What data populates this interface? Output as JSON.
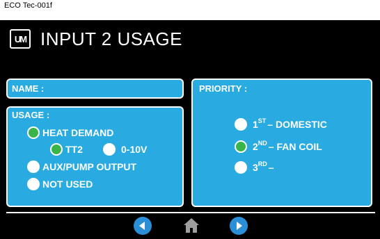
{
  "caption": "ECO Tec-001f",
  "header": {
    "title": "INPUT 2 USAGE",
    "logo_text": "UM"
  },
  "name_panel": {
    "label": "NAME :"
  },
  "usage_panel": {
    "label": "USAGE :",
    "options": {
      "heat_demand": {
        "label": "HEAT DEMAND",
        "selected": true
      },
      "tt2": {
        "label": "TT2",
        "selected": true
      },
      "zero_ten_v": {
        "label": "0-10V",
        "selected": false
      },
      "aux_pump": {
        "label": "AUX/PUMP OUTPUT",
        "selected": false
      },
      "not_used": {
        "label": "NOT USED",
        "selected": false
      }
    }
  },
  "priority_panel": {
    "label": "PRIORITY :",
    "options": [
      {
        "num": "1",
        "sup": "ST",
        "text": "– DOMESTIC",
        "selected": false
      },
      {
        "num": "2",
        "sup": "ND",
        "text": "– FAN COIL",
        "selected": true
      },
      {
        "num": "3",
        "sup": "RD",
        "text": "–",
        "selected": false
      }
    ]
  },
  "nav": {
    "prev_icon": "chevron-left-icon",
    "home_icon": "home-icon",
    "next_icon": "chevron-right-icon"
  },
  "colors": {
    "panel": "#29abe2",
    "selected": "#39b54a",
    "nav": "#2a8fd6",
    "screen": "#000000"
  }
}
